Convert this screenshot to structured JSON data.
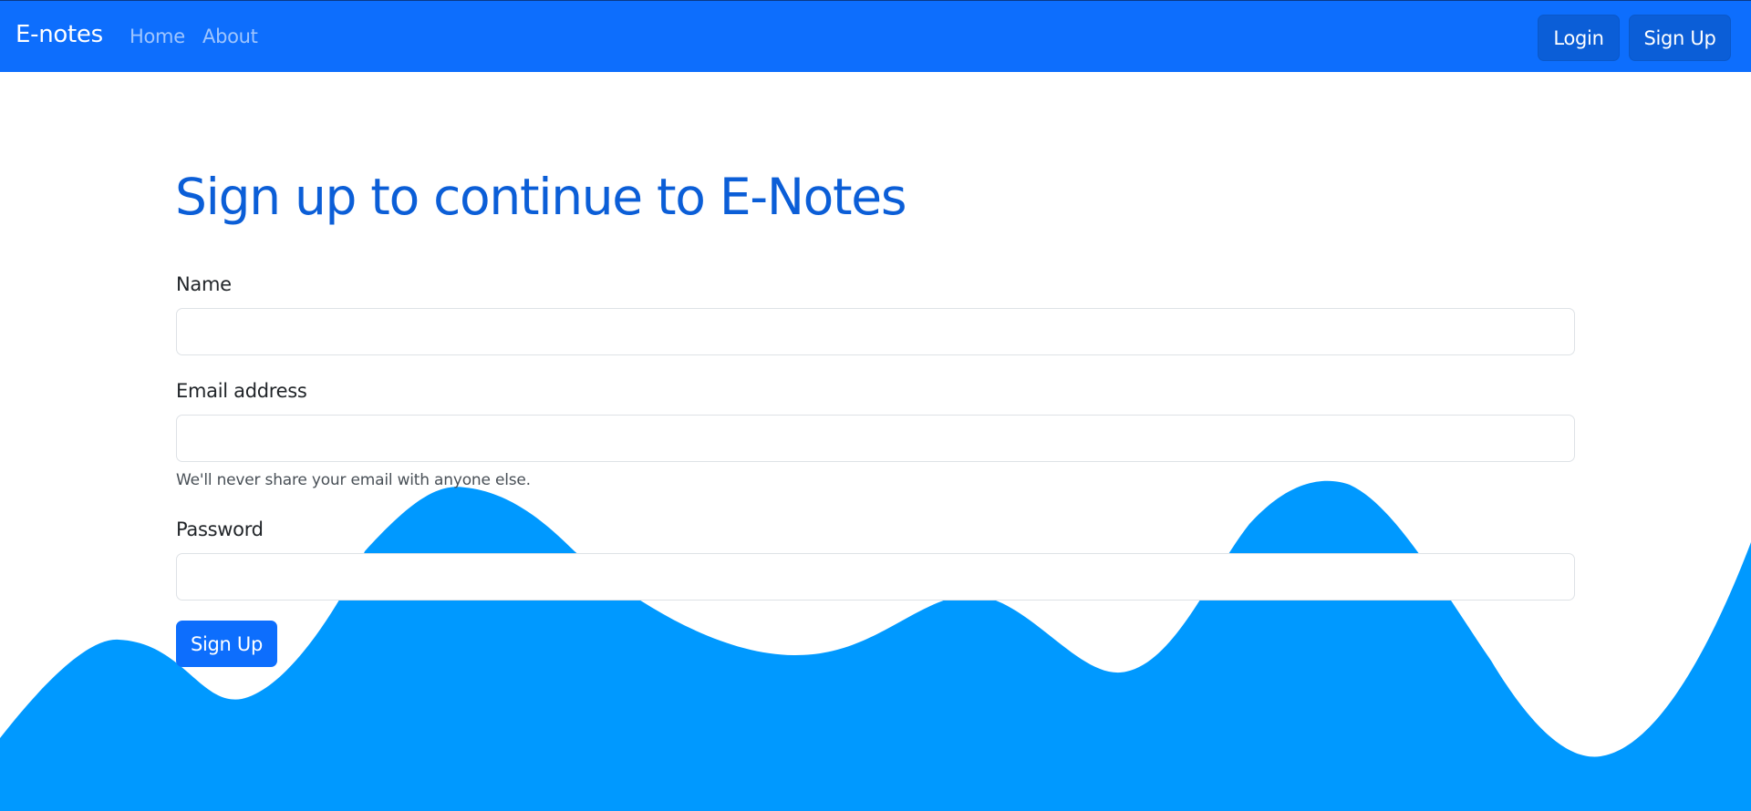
{
  "navbar": {
    "brand": "E-notes",
    "links": [
      "Home",
      "About"
    ],
    "login_label": "Login",
    "signup_label": "Sign Up"
  },
  "form": {
    "title": "Sign up to continue to E-Notes",
    "name_label": "Name",
    "name_value": "",
    "email_label": "Email address",
    "email_value": "",
    "email_help": "We'll never share your email with anyone else.",
    "password_label": "Password",
    "password_value": "",
    "submit_label": "Sign Up"
  },
  "colors": {
    "primary": "#0d6efd",
    "title": "#0b5ed7",
    "wave": "#0099ff"
  }
}
